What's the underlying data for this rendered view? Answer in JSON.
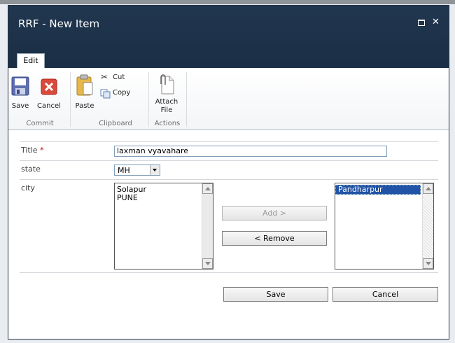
{
  "dialog": {
    "title": "RRF - New Item"
  },
  "ribbon": {
    "tab": "Edit",
    "buttons": {
      "save": "Save",
      "cancel": "Cancel",
      "paste": "Paste",
      "cut": "Cut",
      "copy": "Copy",
      "attach_line1": "Attach",
      "attach_line2": "File"
    },
    "groups": {
      "commit": "Commit",
      "clipboard": "Clipboard",
      "actions": "Actions"
    }
  },
  "form": {
    "title_label": "Title",
    "required_marker": "*",
    "title_value": "laxman vyavahare",
    "state_label": "state",
    "state_value": "MH",
    "city_label": "city",
    "available_cities": [
      "Solapur",
      "PUNE"
    ],
    "selected_cities": [
      "Pandharpur"
    ],
    "add_button": "Add >",
    "remove_button": "< Remove"
  },
  "footer": {
    "save": "Save",
    "cancel": "Cancel"
  },
  "colors": {
    "title_bar": "#1e334b",
    "accent_selected": "#2153a6",
    "required": "#cc0000"
  }
}
